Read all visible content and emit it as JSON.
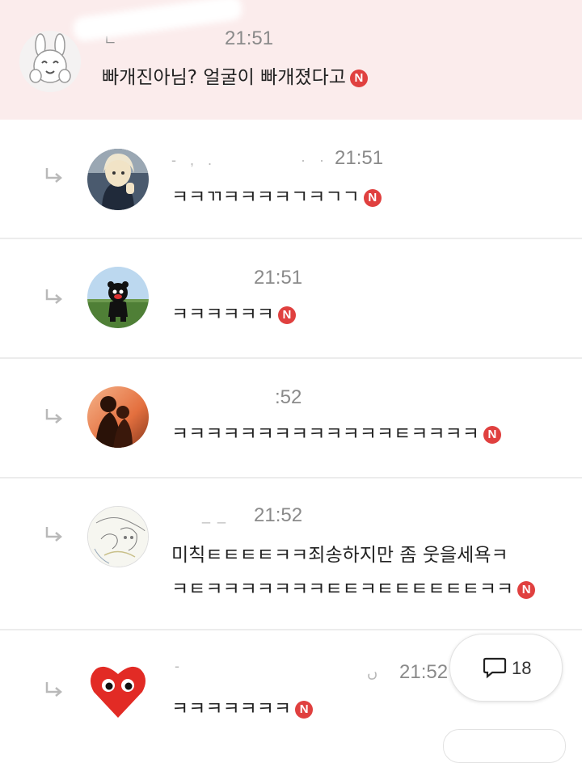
{
  "comments": [
    {
      "author_fragment": "ㄴ",
      "time": "21:51",
      "text": "빠개진아님? 얼굴이 빠개졌다고",
      "badge": "N",
      "avatar": "rabbit-character-avatar"
    },
    {
      "author_fragment": "- , .",
      "time_prefix": "· ·",
      "time": "21:51",
      "text": "ㅋㅋㄲㅋㅋㅋㅋㄱㅋㄱㄱ",
      "badge": "N",
      "avatar": "blonde-person-avatar"
    },
    {
      "time": "21:51",
      "text": "ㅋㅋㅋㅋㅋㅋ",
      "badge": "N",
      "avatar": "black-bear-mascot-avatar"
    },
    {
      "time": ":52",
      "text": "ㅋㅋㅋㅋㅋㅋㅋㅋㅋㅋㅋㅋㅋㅌㅋㅋㅋㅋ",
      "badge": "N",
      "avatar": "sunset-silhouette-avatar"
    },
    {
      "author_fragment": "_ _",
      "time": "21:52",
      "text_line1": "미칙ㅌㅌㅌㅌㅋㅋ죄송하지만 좀 웃을세욕ㅋ",
      "text_line2": "ㅋㅌㅋㅋㅋㅋㅋㅋㅋㅌㅌㅋㅌㅌㅌㅌㅌㅌㅋㅋ",
      "badge": "N",
      "avatar": "sketch-drawing-avatar"
    },
    {
      "author_fragment": "-",
      "time_prefix": "ں",
      "time": "21:52",
      "text": "ㅋㅋㅋㅋㅋㅋㅋ",
      "badge": "N",
      "avatar": "red-heart-eyes-avatar"
    }
  ],
  "floating_button": {
    "count": "18",
    "icon": "comment-bubble-icon"
  },
  "colors": {
    "highlight_background": "#fbecec",
    "badge_red": "#e0403f",
    "meta_gray": "#8a8a8a"
  }
}
